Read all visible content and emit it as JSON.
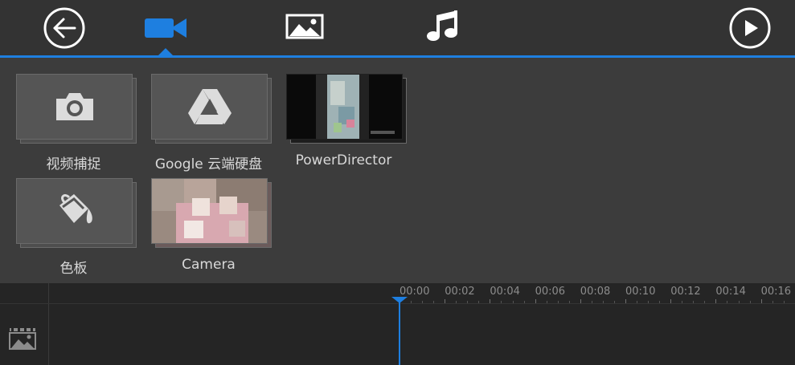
{
  "toolbar": {
    "back_icon": "back-arrow-icon",
    "tabs": [
      {
        "icon": "video-camera-icon",
        "active": true
      },
      {
        "icon": "image-icon",
        "active": false
      },
      {
        "icon": "music-note-icon",
        "active": false
      }
    ],
    "play_icon": "play-icon",
    "accent_color": "#1e7fe0"
  },
  "sources": [
    {
      "label": "视频捕捉",
      "icon": "camera-icon"
    },
    {
      "label": "Google 云端硬盘",
      "icon": "google-drive-icon"
    },
    {
      "label": "PowerDirector",
      "icon": "folder-thumbnail"
    },
    {
      "label": "色板",
      "icon": "paint-bucket-icon"
    },
    {
      "label": "Camera",
      "icon": "folder-thumbnail"
    }
  ],
  "timeline": {
    "ticks": [
      "00:00",
      "00:02",
      "00:04",
      "00:06",
      "00:08",
      "00:10",
      "00:12",
      "00:14",
      "00:16"
    ],
    "track_icon": "image-track-icon"
  }
}
